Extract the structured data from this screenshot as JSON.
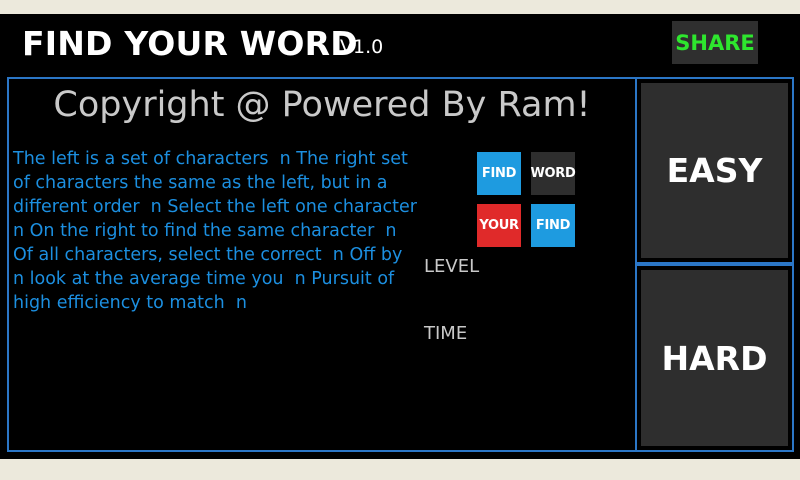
{
  "header": {
    "title": "FIND YOUR WORD",
    "version": "V1.0",
    "share_label": "SHARE",
    "share_color": "#2ee62e"
  },
  "main": {
    "copyright": "Copyright @ Powered By Ram!",
    "instructions": "The left is a set of characters  n The right set of characters the same as the left, but in a different order  n Select the left one character  n On the right to find the same character  n Of all characters, select the correct  n Off by  n look at the average time you  n Pursuit of high efficiency to match  n",
    "logo_tiles": [
      {
        "text": "FIND",
        "color": "#1e9be0"
      },
      {
        "text": "WORD",
        "color": "#2e2e2e"
      },
      {
        "text": "YOUR",
        "color": "#e02a2a"
      },
      {
        "text": "FIND",
        "color": "#1e9be0"
      }
    ],
    "level_label": "LEVEL",
    "time_label": "TIME"
  },
  "modes": {
    "easy_label": "EASY",
    "hard_label": "HARD"
  },
  "colors": {
    "background": "#000000",
    "accent_border": "#2b76c6",
    "instruction_text": "#1c8fe0",
    "button_bg": "#2e2e2e"
  }
}
